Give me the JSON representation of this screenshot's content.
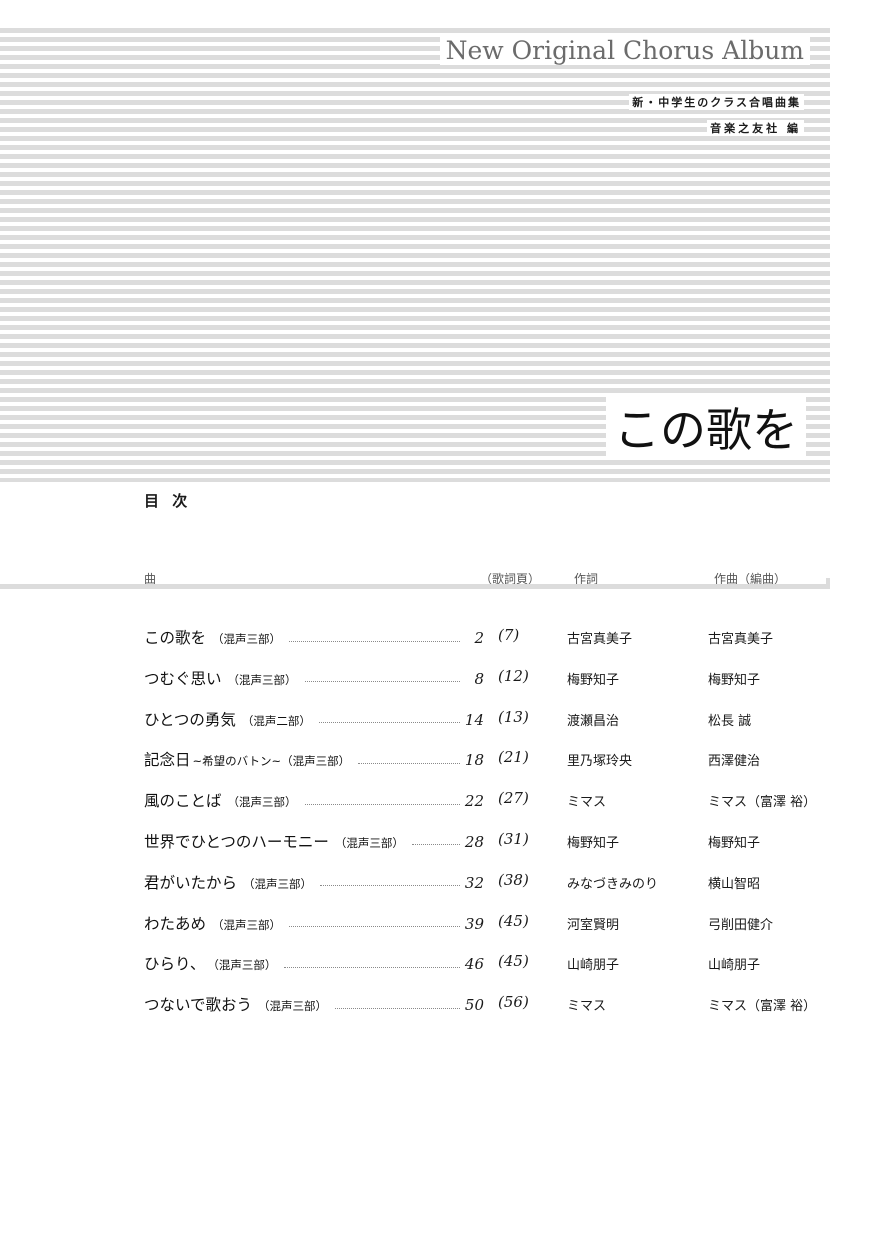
{
  "header": {
    "series_title": "New Original Chorus Album",
    "collection": "新・中学生のクラス合唱曲集",
    "publisher": "音楽之友社 編",
    "album_title": "この歌を"
  },
  "toc": {
    "heading": "目 次",
    "columns": {
      "song": "曲",
      "lyrics_page": "（歌詞頁）",
      "lyricist": "作詞",
      "composer": "作曲（編曲）"
    },
    "songs": [
      {
        "title": "この歌を",
        "voicing": "（混声三部）",
        "page": "2",
        "lyrics_page": "(7)",
        "lyricist": "古宮真美子",
        "composer": "古宮真美子"
      },
      {
        "title": "つむぐ思い",
        "voicing": "（混声三部）",
        "page": "8",
        "lyrics_page": "(12)",
        "lyricist": "梅野知子",
        "composer": "梅野知子"
      },
      {
        "title": "ひとつの勇気",
        "voicing": "（混声二部）",
        "page": "14",
        "lyrics_page": "(13)",
        "lyricist": "渡瀬昌治",
        "composer": "松長 誠"
      },
      {
        "title": "記念日",
        "voicing": "~希望のバトン~（混声三部）",
        "page": "18",
        "lyrics_page": "(21)",
        "lyricist": "里乃塚玲央",
        "composer": "西澤健治"
      },
      {
        "title": "風のことば",
        "voicing": "（混声三部）",
        "page": "22",
        "lyrics_page": "(27)",
        "lyricist": "ミマス",
        "composer": "ミマス（富澤 裕）"
      },
      {
        "title": "世界でひとつのハーモニー",
        "voicing": "（混声三部）",
        "page": "28",
        "lyrics_page": "(31)",
        "lyricist": "梅野知子",
        "composer": "梅野知子"
      },
      {
        "title": "君がいたから",
        "voicing": "（混声三部）",
        "page": "32",
        "lyrics_page": "(38)",
        "lyricist": "みなづきみのり",
        "composer": "横山智昭"
      },
      {
        "title": "わたあめ",
        "voicing": "（混声三部）",
        "page": "39",
        "lyrics_page": "(45)",
        "lyricist": "河室賢明",
        "composer": "弓削田健介"
      },
      {
        "title": "ひらり、",
        "voicing": "（混声三部）",
        "page": "46",
        "lyrics_page": "(45)",
        "lyricist": "山崎朋子",
        "composer": "山崎朋子"
      },
      {
        "title": "つないで歌おう",
        "voicing": "（混声三部）",
        "page": "50",
        "lyrics_page": "(56)",
        "lyricist": "ミマス",
        "composer": "ミマス（富澤 裕）"
      }
    ]
  }
}
